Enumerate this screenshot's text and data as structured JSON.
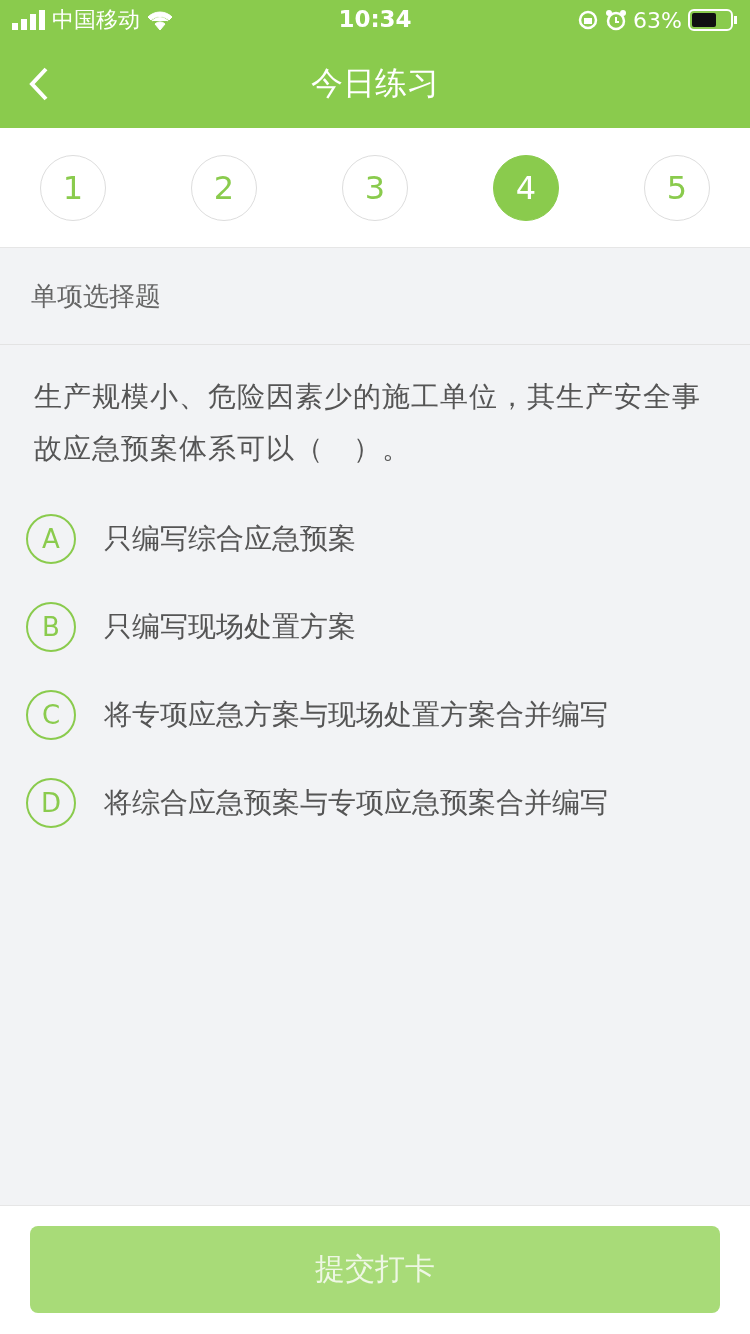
{
  "status_bar": {
    "carrier": "中国移动",
    "time": "10:34",
    "battery": "63%"
  },
  "nav": {
    "title": "今日练习"
  },
  "steps": [
    {
      "label": "1",
      "selected": false
    },
    {
      "label": "2",
      "selected": false
    },
    {
      "label": "3",
      "selected": false
    },
    {
      "label": "4",
      "selected": true
    },
    {
      "label": "5",
      "selected": false
    }
  ],
  "question": {
    "type": "单项选择题",
    "text": "生产规模小、危险因素少的施工单位，其生产安全事故应急预案体系可以（　）。",
    "options": [
      {
        "letter": "A",
        "text": "只编写综合应急预案",
        "selected": false
      },
      {
        "letter": "B",
        "text": "只编写现场处置方案",
        "selected": false
      },
      {
        "letter": "C",
        "text": "将专项应急方案与现场处置方案合并编写",
        "selected": false
      },
      {
        "letter": "D",
        "text": "将综合应急预案与专项应急预案合并编写",
        "selected": false
      }
    ]
  },
  "submit": {
    "label": "提交打卡",
    "disabled": true
  }
}
